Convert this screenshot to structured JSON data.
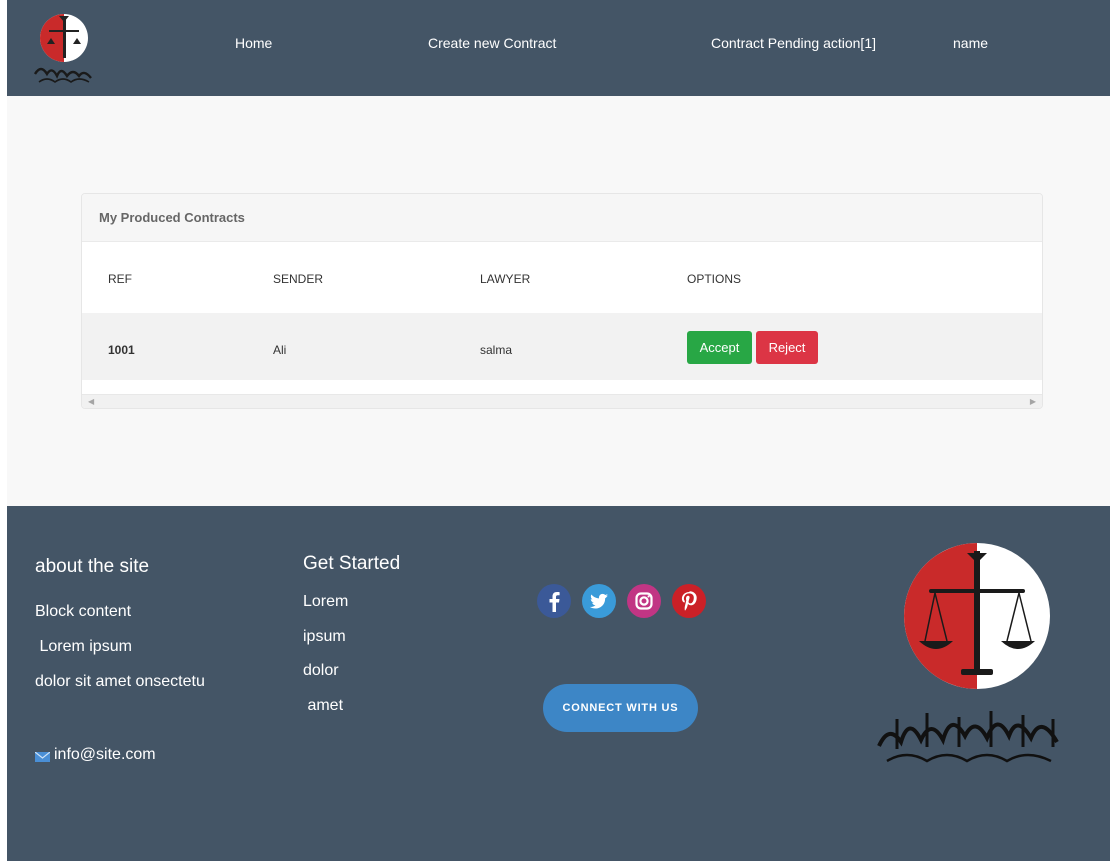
{
  "nav": {
    "logo_alt": "Ministry of Justice logo",
    "links": [
      "Home",
      "Create new Contract",
      "Contract Pending action[1]",
      "name"
    ]
  },
  "card": {
    "title": "My Produced Contracts",
    "columns": [
      "REF",
      "SENDER",
      "LAWYER",
      "OPTIONS"
    ],
    "rows": [
      {
        "ref": "1001",
        "sender": "Ali",
        "lawyer": "salma",
        "accept_label": "Accept",
        "reject_label": "Reject"
      }
    ]
  },
  "footer": {
    "about": {
      "heading": "about the site",
      "lines": [
        "Block content",
        " Lorem ipsum",
        "dolor sit amet onsectetu"
      ],
      "email": "info@site.com"
    },
    "get_started": {
      "heading": "Get Started",
      "links": [
        "Lorem",
        "ipsum",
        "dolor",
        " amet"
      ]
    },
    "social": [
      "facebook-icon",
      "twitter-icon",
      "instagram-icon",
      "pinterest-icon"
    ],
    "connect_label": "CONNECT WITH US"
  },
  "colors": {
    "nav_bg": "#445566",
    "accept": "#28a745",
    "reject": "#dc3545",
    "connect": "#3d86c6"
  }
}
